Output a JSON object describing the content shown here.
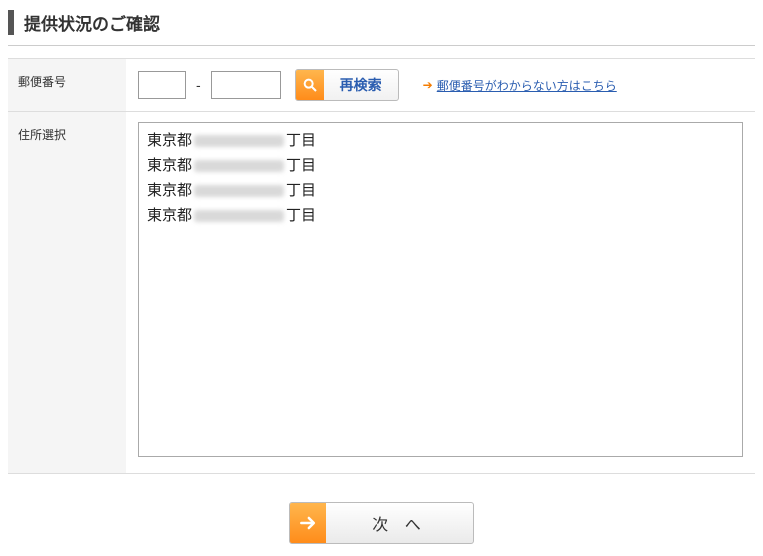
{
  "page_title": "提供状況のご確認",
  "postal": {
    "label": "郵便番号",
    "part1": "",
    "part2": "",
    "search_button": "再検索",
    "help_link": "郵便番号がわからない方はこちら"
  },
  "address": {
    "label": "住所選択",
    "items": [
      {
        "prefix": "東京都",
        "suffix": "丁目"
      },
      {
        "prefix": "東京都",
        "suffix": "丁目"
      },
      {
        "prefix": "東京都",
        "suffix": "丁目"
      },
      {
        "prefix": "東京都",
        "suffix": "丁目"
      }
    ]
  },
  "next_button": "次 へ"
}
